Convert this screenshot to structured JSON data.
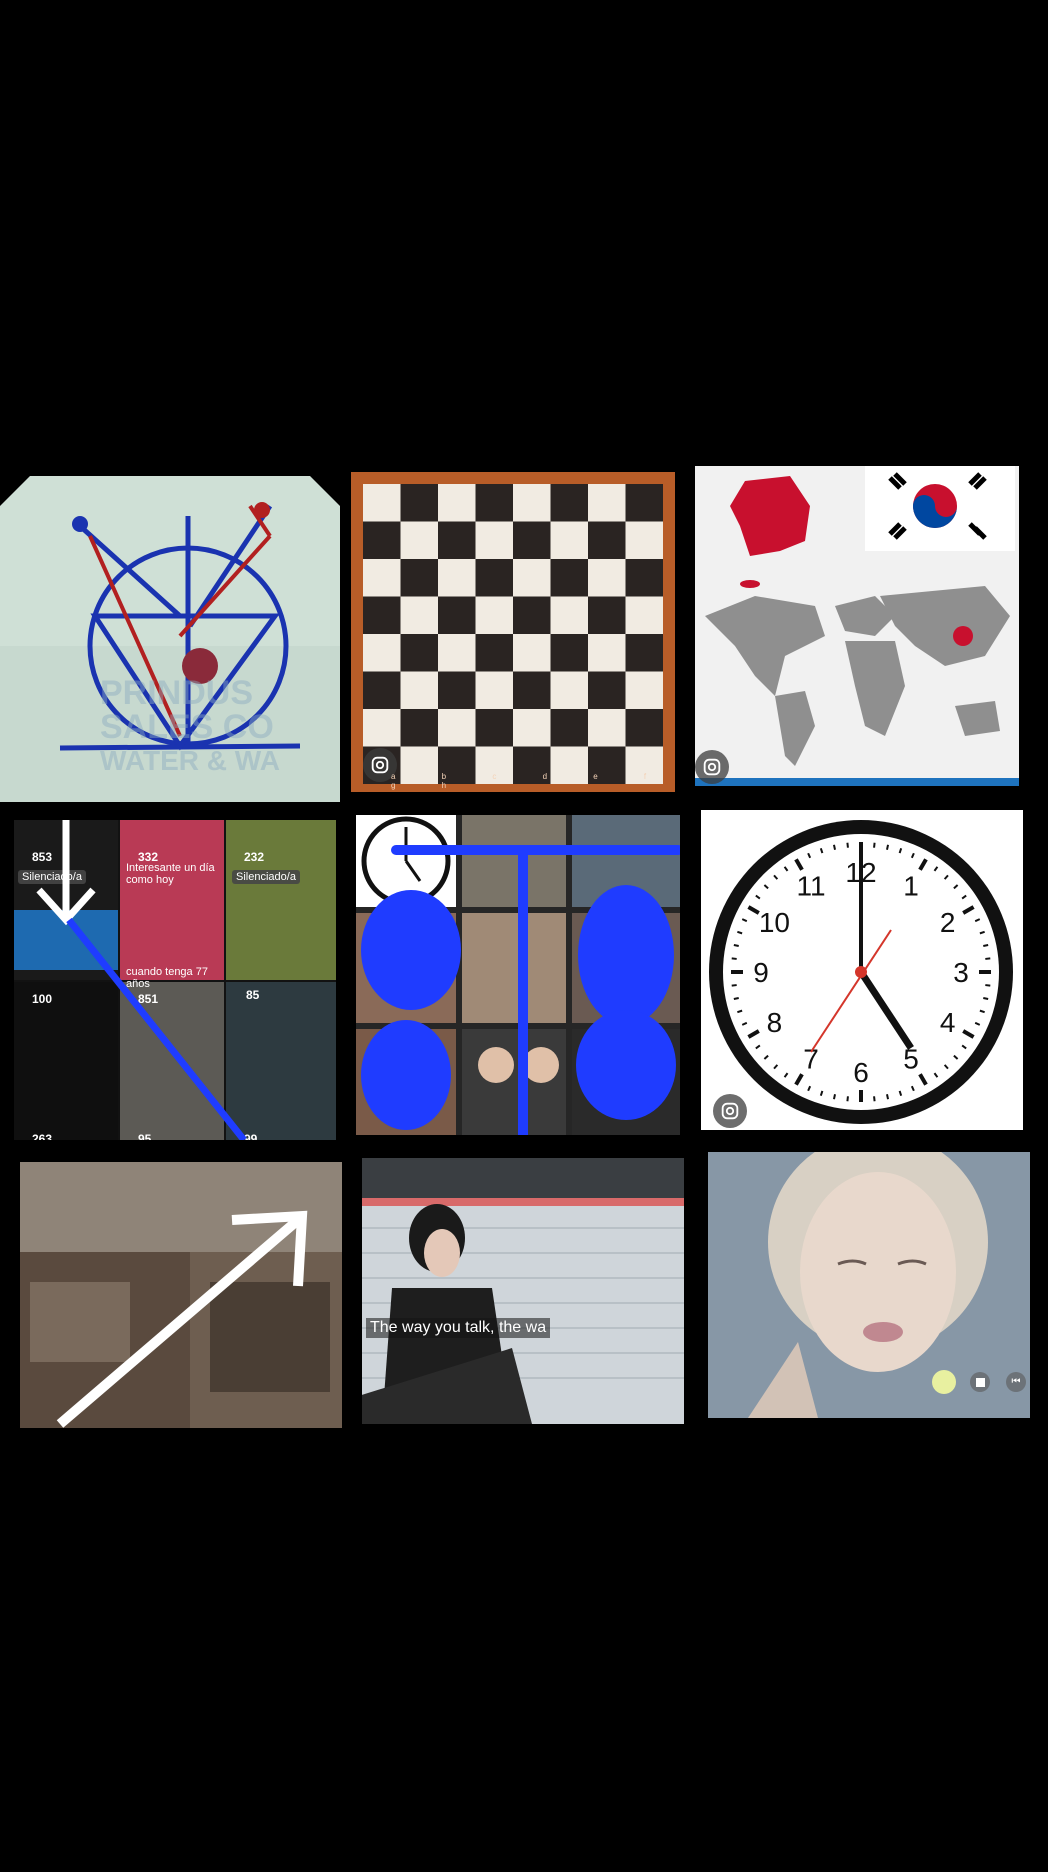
{
  "grid": {
    "tiles": [
      {
        "id": "symbol-drawing",
        "overlay_text": [
          "PRINDUS",
          "SALES CO",
          "WATER & WA"
        ]
      },
      {
        "id": "chessboard",
        "file_labels": "a b c d e f g h"
      },
      {
        "id": "korea-map"
      },
      {
        "id": "tiktok-grid",
        "views": [
          "853",
          "332",
          "232",
          "100",
          "851",
          "263",
          "95",
          "99"
        ],
        "muted_label": "Silenciado/a",
        "caption_top": "Interesante un día como hoy",
        "caption_bottom": "cuando tenga 77 años",
        "count_mid": "85"
      },
      {
        "id": "image-search-collage"
      },
      {
        "id": "wall-clock",
        "numbers": [
          "12",
          "1",
          "2",
          "3",
          "4",
          "5",
          "6",
          "7",
          "8",
          "9",
          "10",
          "11"
        ]
      },
      {
        "id": "street-photo"
      },
      {
        "id": "video-frame",
        "subtitle": "The way you talk, the wa"
      },
      {
        "id": "portrait"
      }
    ]
  },
  "colors": {
    "background": "#000000",
    "scribble": "#1f3cff",
    "korea_red": "#c8102e",
    "clock_hand_red": "#d4362b"
  }
}
